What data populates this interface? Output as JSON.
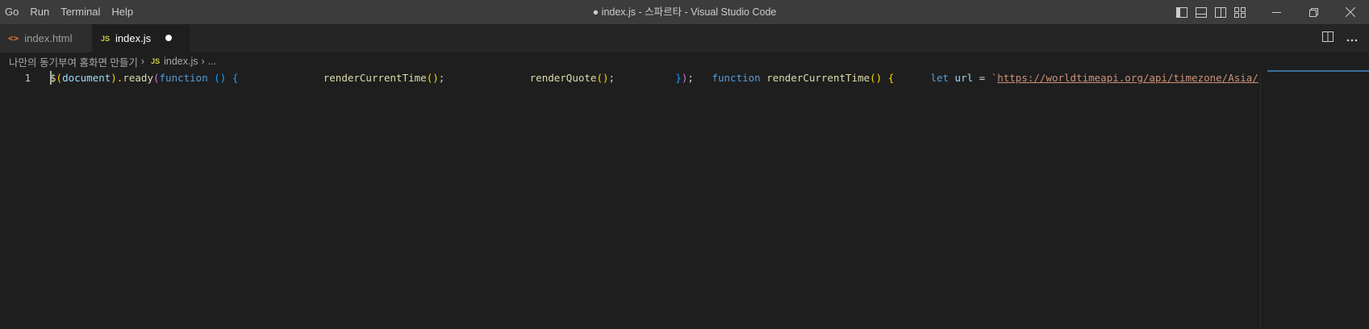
{
  "menubar": {
    "items": [
      "Go",
      "Run",
      "Terminal",
      "Help"
    ]
  },
  "window_title": "● index.js - 스파르타 - Visual Studio Code",
  "tabs": [
    {
      "label": "index.html",
      "icon": "html-file-icon",
      "active": false
    },
    {
      "label": "index.js",
      "icon": "js-file-icon",
      "active": true,
      "dirty": true
    }
  ],
  "file_icon_text": {
    "js": "JS"
  },
  "breadcrumb": {
    "folder": "나만의 동기부여 홈화면 만들기",
    "file": "index.js",
    "more": "..."
  },
  "editor": {
    "line_number": "1",
    "tokens": [
      {
        "t": "$",
        "c": "tok-fn"
      },
      {
        "t": "(",
        "c": "tok-p1"
      },
      {
        "t": "document",
        "c": "tok-var"
      },
      {
        "t": ").",
        "c": "tok-p1"
      },
      {
        "t": "ready",
        "c": "tok-fn"
      },
      {
        "t": "(",
        "c": "tok-p2"
      },
      {
        "t": "function",
        "c": "tok-kw"
      },
      {
        "t": " ",
        "c": "tok-plain"
      },
      {
        "t": "()",
        "c": "tok-p3"
      },
      {
        "t": " ",
        "c": "tok-plain"
      },
      {
        "t": "{",
        "c": "tok-p3"
      },
      {
        "t": "              ",
        "c": "tok-plain"
      },
      {
        "t": "renderCurrentTime",
        "c": "tok-fn"
      },
      {
        "t": "()",
        "c": "tok-p1"
      },
      {
        "t": ";",
        "c": "tok-plain"
      },
      {
        "t": "              ",
        "c": "tok-plain"
      },
      {
        "t": "renderQuote",
        "c": "tok-fn"
      },
      {
        "t": "()",
        "c": "tok-p1"
      },
      {
        "t": ";",
        "c": "tok-plain"
      },
      {
        "t": "          ",
        "c": "tok-plain"
      },
      {
        "t": "}",
        "c": "tok-p3"
      },
      {
        "t": ")",
        "c": "tok-p2"
      },
      {
        "t": ";   ",
        "c": "tok-plain"
      },
      {
        "t": "function",
        "c": "tok-kw"
      },
      {
        "t": " ",
        "c": "tok-plain"
      },
      {
        "t": "renderCurrentTime",
        "c": "tok-fn"
      },
      {
        "t": "()",
        "c": "tok-p1"
      },
      {
        "t": " ",
        "c": "tok-plain"
      },
      {
        "t": "{",
        "c": "tok-p1"
      },
      {
        "t": "      ",
        "c": "tok-plain"
      },
      {
        "t": "let",
        "c": "tok-kw"
      },
      {
        "t": " ",
        "c": "tok-plain"
      },
      {
        "t": "url",
        "c": "tok-var"
      },
      {
        "t": " = ",
        "c": "tok-plain"
      },
      {
        "t": "`",
        "c": "tok-str"
      },
      {
        "t": "https://worldtimeapi.org/api/timezone/Asia/",
        "c": "tok-url"
      }
    ]
  },
  "colors": {
    "titlebar_bg": "#3c3c3c",
    "editor_bg": "#1e1e1e",
    "tab_inactive_bg": "#2d2d2d",
    "html_icon": "#e37933",
    "js_icon": "#cbcb41"
  }
}
